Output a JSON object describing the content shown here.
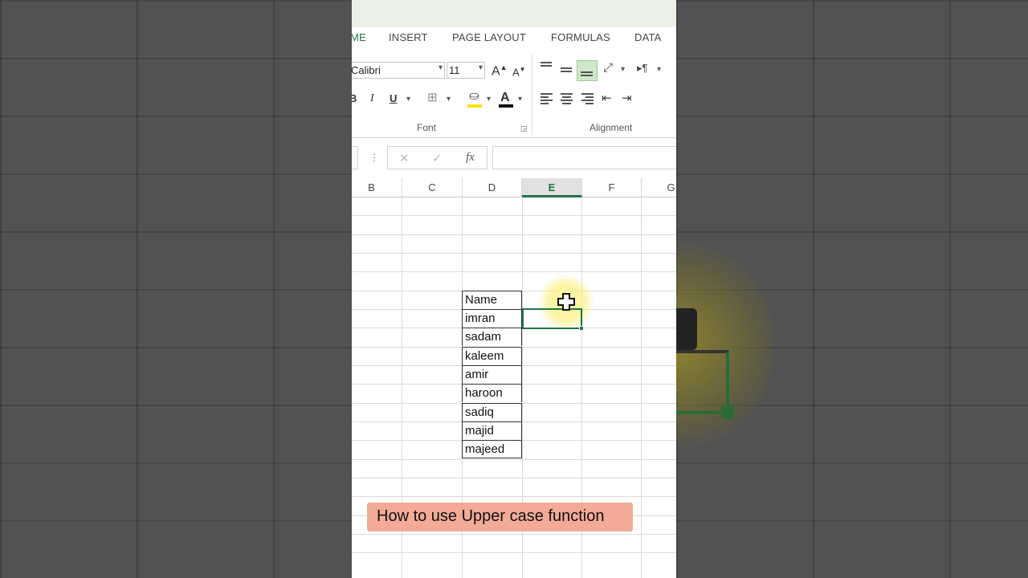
{
  "ribbon": {
    "tabs": [
      "ME",
      "INSERT",
      "PAGE LAYOUT",
      "FORMULAS",
      "DATA"
    ],
    "font_name": "Calibri",
    "font_size": "11",
    "font_group_label": "Font",
    "alignment_group_label": "Alignment",
    "bold_label": "B",
    "italic_label": "I",
    "underline_label": "U",
    "grow_font_label": "A",
    "shrink_font_label": "A",
    "font_color_label": "A"
  },
  "formula_bar": {
    "cancel_symbol": "✕",
    "enter_symbol": "✓",
    "fx_label": "fx",
    "value": ""
  },
  "columns": [
    {
      "label": "B"
    },
    {
      "label": "C"
    },
    {
      "label": "D"
    },
    {
      "label": "E",
      "active": true
    },
    {
      "label": "F"
    },
    {
      "label": "G"
    }
  ],
  "cells": [
    "Name",
    "imran",
    "sadam",
    "kaleem",
    "amir",
    "haroon",
    "sadiq",
    "majid",
    "majeed"
  ],
  "caption": "How to use Upper case function",
  "colors": {
    "accent": "#217346",
    "caption_bg": "#f3aa96",
    "highlight": "#fcf596"
  }
}
